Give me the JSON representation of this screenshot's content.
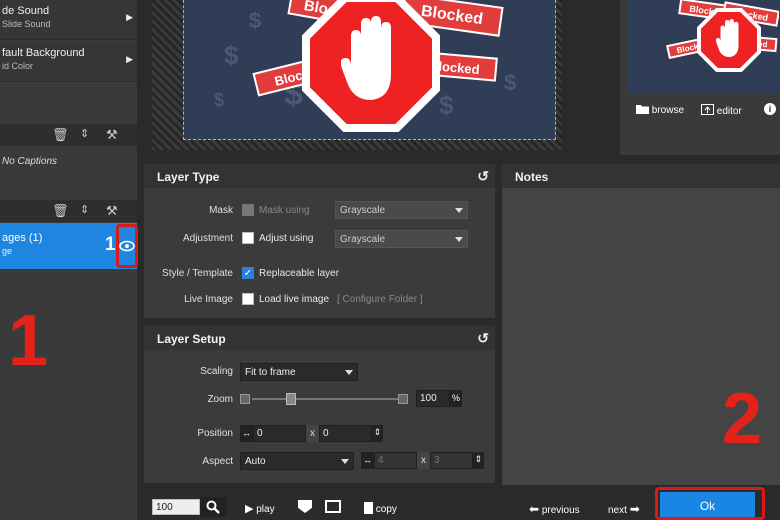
{
  "left_panel": {
    "slide_items": [
      {
        "title": "de Sound",
        "subtitle": "Slide Sound"
      },
      {
        "title": "fault Background",
        "subtitle": "id Color"
      }
    ],
    "captions_text": "No Captions",
    "layer": {
      "title": "ages (1)",
      "subtitle": "ge",
      "number": "1"
    },
    "step_label": "1"
  },
  "canvas": {
    "sticker_texts": [
      "Blocked",
      "Blocked",
      "Blocked",
      "Blocked"
    ],
    "dollar_glyph": "$"
  },
  "preview": {
    "browse_label": "browse",
    "editor_label": "editor",
    "info_label": "i"
  },
  "layer_type": {
    "title": "Layer Type",
    "mask": {
      "label": "Mask",
      "option": "Mask using",
      "select": "Grayscale"
    },
    "adjustment": {
      "label": "Adjustment",
      "option": "Adjust using",
      "select": "Grayscale"
    },
    "style": {
      "label": "Style / Template",
      "option": "Replaceable layer"
    },
    "live": {
      "label": "Live Image",
      "option": "Load live image",
      "link": "[ Configure Folder ]"
    }
  },
  "notes": {
    "title": "Notes"
  },
  "layer_setup": {
    "title": "Layer Setup",
    "scaling": {
      "label": "Scaling",
      "value": "Fit to frame"
    },
    "zoom": {
      "label": "Zoom",
      "value": "100",
      "unit": "%",
      "level": 0.25
    },
    "position": {
      "label": "Position",
      "x": "0",
      "sep": "x",
      "y": "0"
    },
    "aspect": {
      "label": "Aspect",
      "value": "Auto",
      "w": "4",
      "sep": "x",
      "h": "3"
    }
  },
  "bottom_bar": {
    "zoom_value": "100",
    "play_label": "play",
    "copy_label": "copy",
    "previous_label": "previous",
    "next_label": "next",
    "ok_label": "Ok"
  },
  "step2_label": "2"
}
